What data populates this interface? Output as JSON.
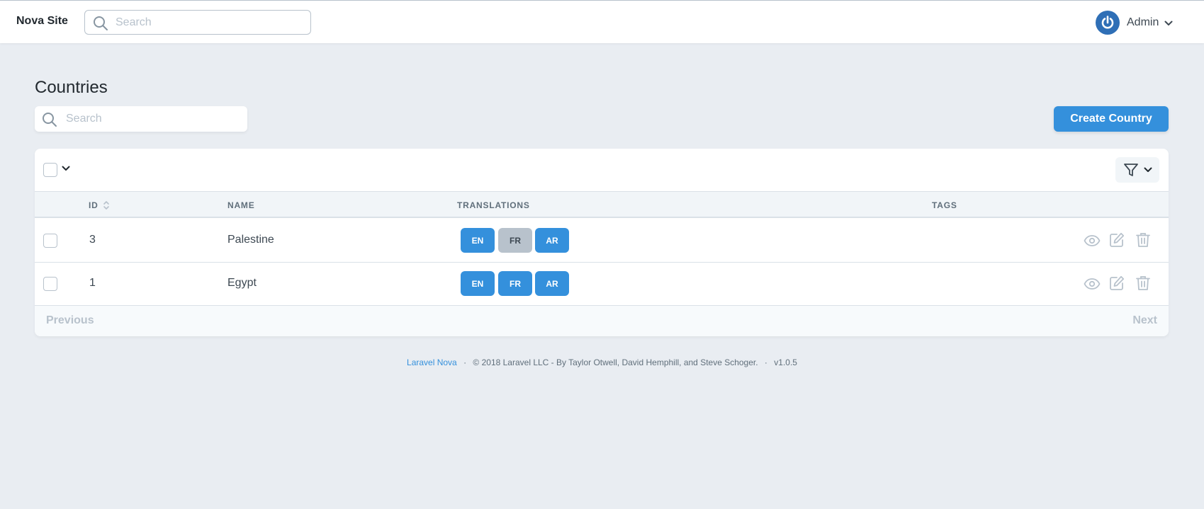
{
  "header": {
    "brand": "Nova Site",
    "search_placeholder": "Search",
    "user_name": "Admin"
  },
  "page": {
    "title": "Countries",
    "search_placeholder": "Search",
    "create_button_label": "Create Country"
  },
  "table": {
    "columns": [
      "ID",
      "NAME",
      "TRANSLATIONS",
      "TAGS"
    ],
    "rows": [
      {
        "id": "3",
        "name": "Palestine",
        "translations": [
          {
            "label": "EN",
            "active": true
          },
          {
            "label": "FR",
            "active": false
          },
          {
            "label": "AR",
            "active": true
          }
        ]
      },
      {
        "id": "1",
        "name": "Egypt",
        "translations": [
          {
            "label": "EN",
            "active": true
          },
          {
            "label": "FR",
            "active": true
          },
          {
            "label": "AR",
            "active": true
          }
        ]
      }
    ]
  },
  "pagination": {
    "previous_label": "Previous",
    "next_label": "Next"
  },
  "footer": {
    "link_text": "Laravel Nova",
    "separator": "·",
    "copyright": "© 2018 Laravel LLC - By Taylor Otwell, David Hemphill, and Steve Schoger.",
    "version": "v1.0.5"
  },
  "colors": {
    "primary": "#3490dc",
    "badge_inactive": "#b8c2cc",
    "background": "#e9edf2"
  },
  "icons": {
    "header_search": "search-icon",
    "logo": "power-icon",
    "user_menu": "chevron-down-icon",
    "filter": "filter-icon",
    "sort": "sort-icon",
    "row_actions": [
      "eye-icon",
      "edit-icon",
      "trash-icon"
    ]
  }
}
